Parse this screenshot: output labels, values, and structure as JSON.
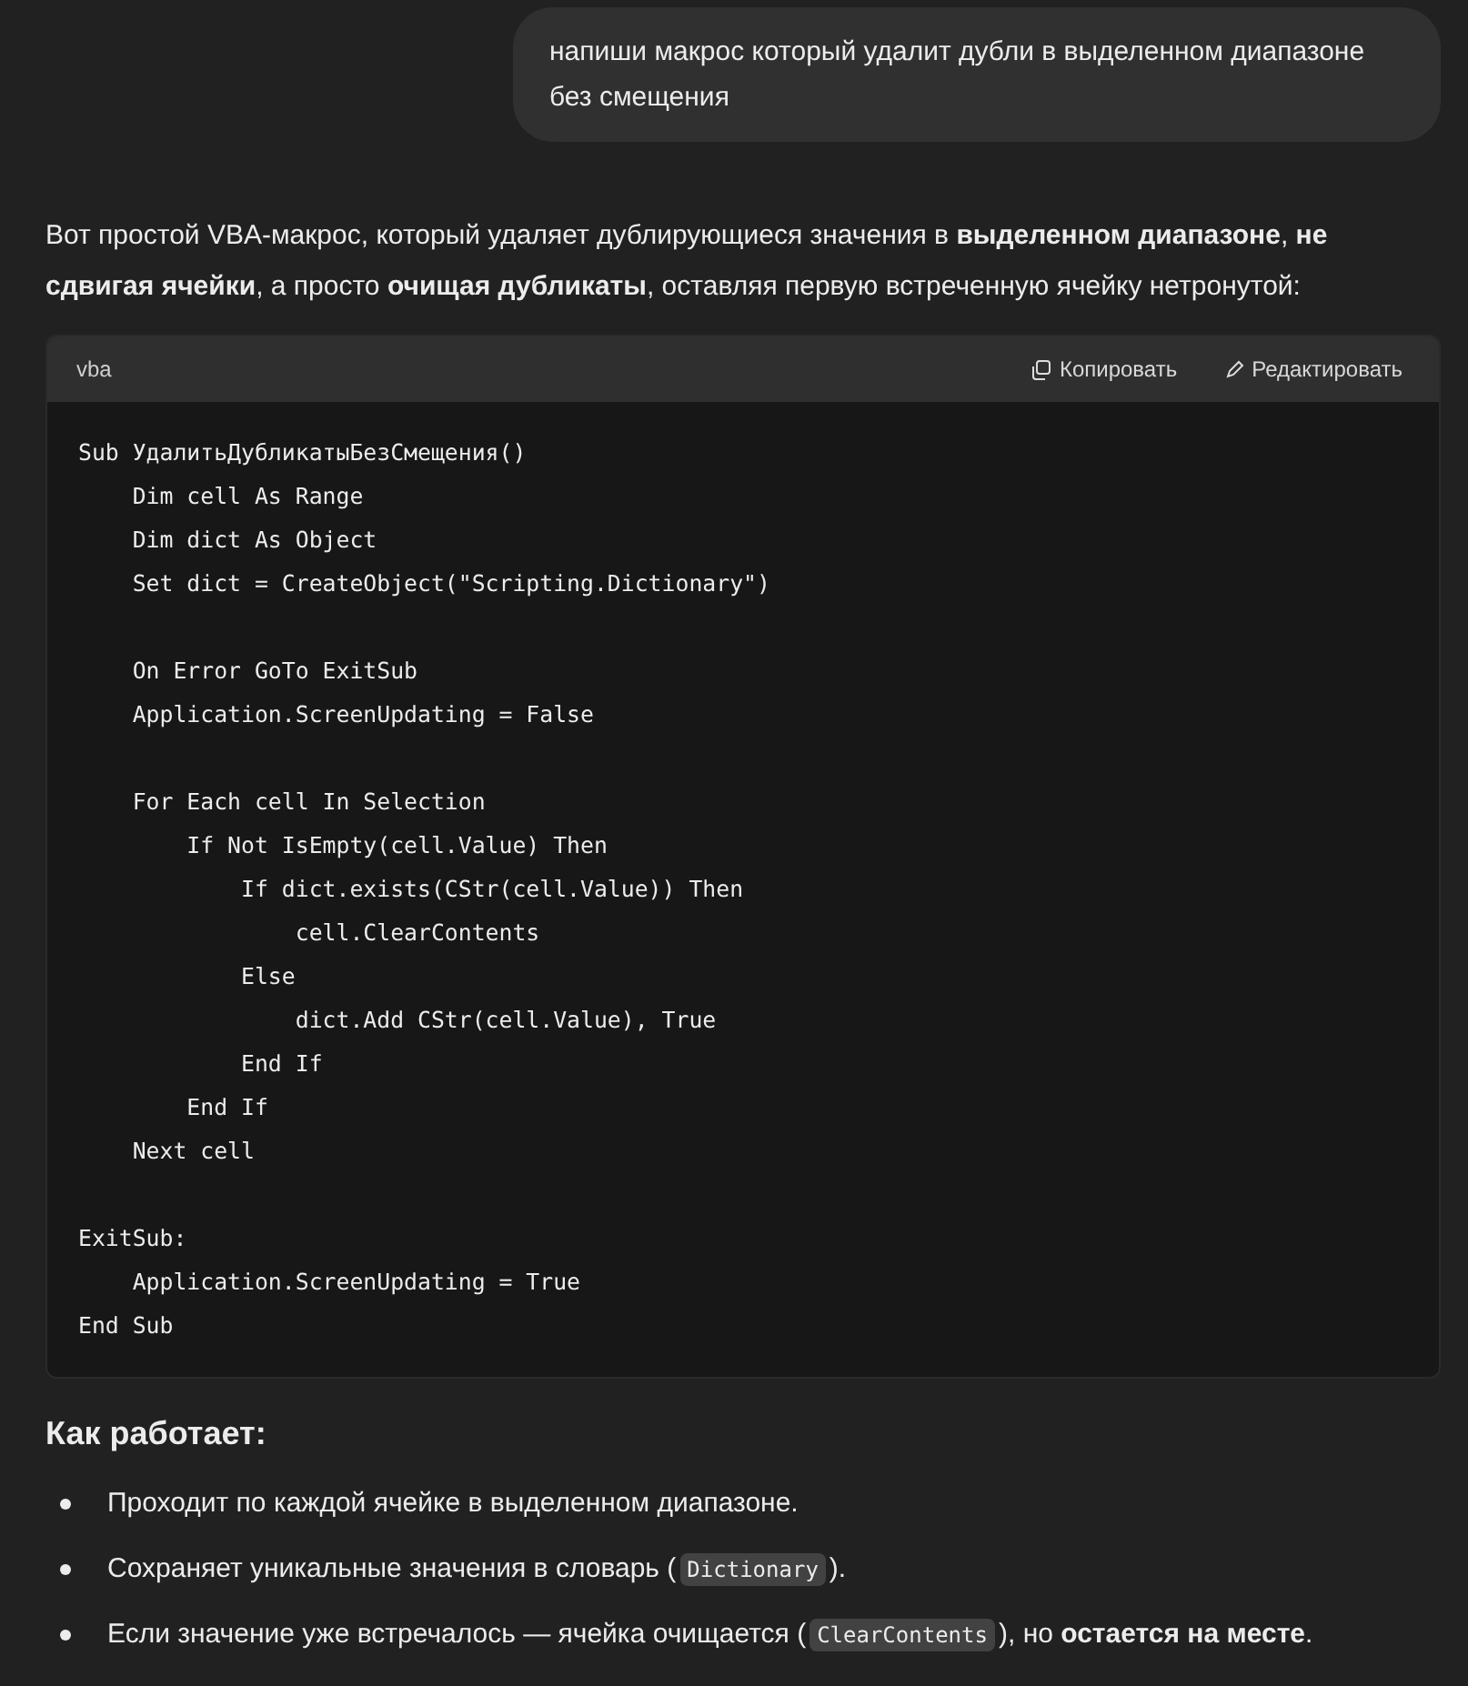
{
  "user_message": "напиши макрос который удалит дубли в выделенном диапазоне без смещения",
  "intro": "Вот простой VBA-макрос, который удаляет дублирующиеся значения в **выделенном диапазоне**, **не сдвигая ячейки**, а просто **очищая дубликаты**, оставляя первую встреченную ячейку нетронутой:",
  "code_block": {
    "language": "vba",
    "copy_button": "Копировать",
    "edit_button": "Редактировать",
    "blocks": [
      [
        "Sub УдалитьДубликатыБезСмещения()",
        "    Dim cell As Range",
        "    Dim dict As Object",
        "    Set dict = CreateObject(\"Scripting.Dictionary\")"
      ],
      [
        "    On Error GoTo ExitSub",
        "    Application.ScreenUpdating = False"
      ],
      [
        "    For Each cell In Selection",
        "        If Not IsEmpty(cell.Value) Then",
        "            If dict.exists(CStr(cell.Value)) Then",
        "                cell.ClearContents",
        "            Else",
        "                dict.Add CStr(cell.Value), True",
        "            End If",
        "        End If",
        "    Next cell"
      ],
      [
        "ExitSub:",
        "    Application.ScreenUpdating = True",
        "End Sub"
      ]
    ]
  },
  "heading": "Как работает:",
  "bullets": [
    {
      "parts": [
        {
          "kind": "text",
          "text": "Проходит по каждой ячейке в выделенном диапазоне."
        }
      ]
    },
    {
      "parts": [
        {
          "kind": "text",
          "text": "Сохраняет уникальные значения в словарь ("
        },
        {
          "kind": "code",
          "text": "Dictionary"
        },
        {
          "kind": "text",
          "text": ")."
        }
      ]
    },
    {
      "parts": [
        {
          "kind": "text",
          "text": "Если значение уже встречалось — ячейка очищается ("
        },
        {
          "kind": "code",
          "text": "ClearContents"
        },
        {
          "kind": "text",
          "text": "), но **остается на месте**."
        }
      ]
    }
  ]
}
